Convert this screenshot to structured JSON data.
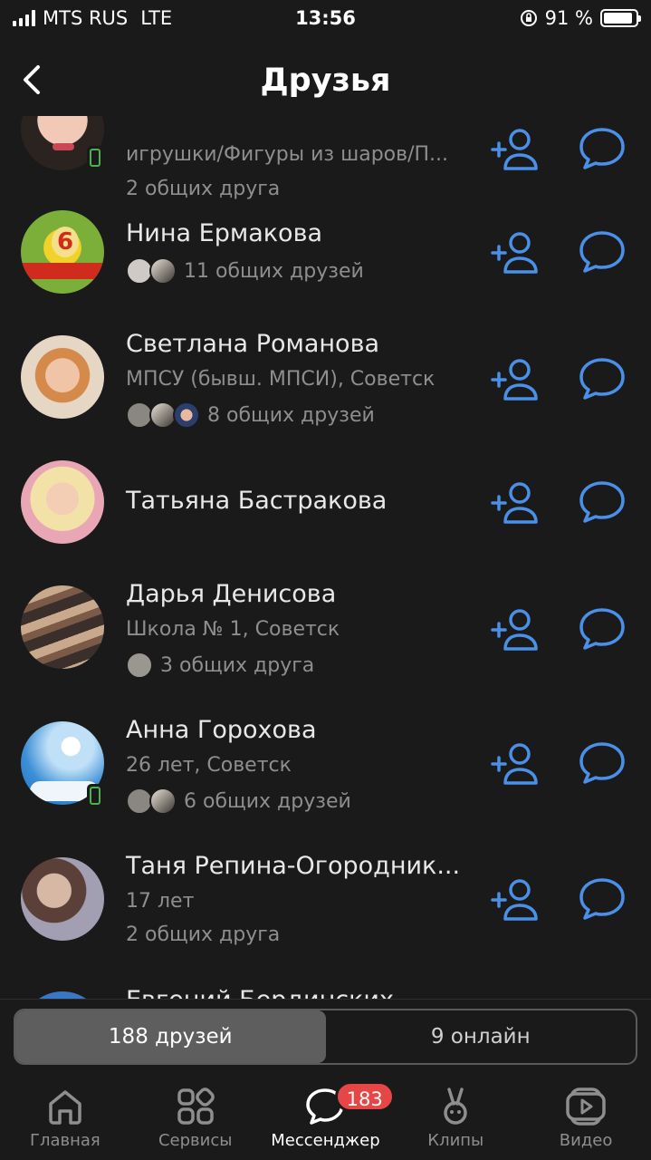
{
  "status": {
    "carrier": "MTS RUS",
    "network": "LTE",
    "time": "13:56",
    "battery": "91 %",
    "battery_level": 0.91
  },
  "header": {
    "title": "Друзья"
  },
  "colors": {
    "accent": "#4a8fe8",
    "online": "#4bb34b",
    "badge": "#e64646"
  },
  "friends": [
    {
      "name": "",
      "subtitle": "игрушки/Фигуры из шаров/П...",
      "mutual": "2 общих друга",
      "online": true
    },
    {
      "name": "Нина Ермакова",
      "subtitle": "",
      "mutual": "11 общих друзей",
      "online": false
    },
    {
      "name": "Светлана Романова",
      "subtitle": "МПСУ (бывш. МПСИ), Советск",
      "mutual": "8 общих друзей",
      "online": false
    },
    {
      "name": "Татьяна Бастракова",
      "subtitle": "",
      "mutual": "",
      "online": false
    },
    {
      "name": "Дарья Денисова",
      "subtitle": "Школа № 1, Советск",
      "mutual": "3 общих друга",
      "online": false
    },
    {
      "name": "Анна Горохова",
      "subtitle": "26 лет, Советск",
      "mutual": "6 общих друзей",
      "online": true
    },
    {
      "name": "Таня Репина-Огородник...",
      "subtitle": "17 лет",
      "mutual": "2 общих друга",
      "online": false
    },
    {
      "name": "Евгений Бердинских",
      "subtitle": "",
      "mutual": "",
      "online": false
    }
  ],
  "segment": {
    "all": "188 друзей",
    "online": "9 онлайн"
  },
  "tabs": [
    {
      "label": "Главная",
      "icon": "home-icon"
    },
    {
      "label": "Сервисы",
      "icon": "services-icon"
    },
    {
      "label": "Мессенджер",
      "icon": "messenger-icon",
      "badge": "183"
    },
    {
      "label": "Клипы",
      "icon": "clips-icon"
    },
    {
      "label": "Видео",
      "icon": "video-icon"
    }
  ]
}
